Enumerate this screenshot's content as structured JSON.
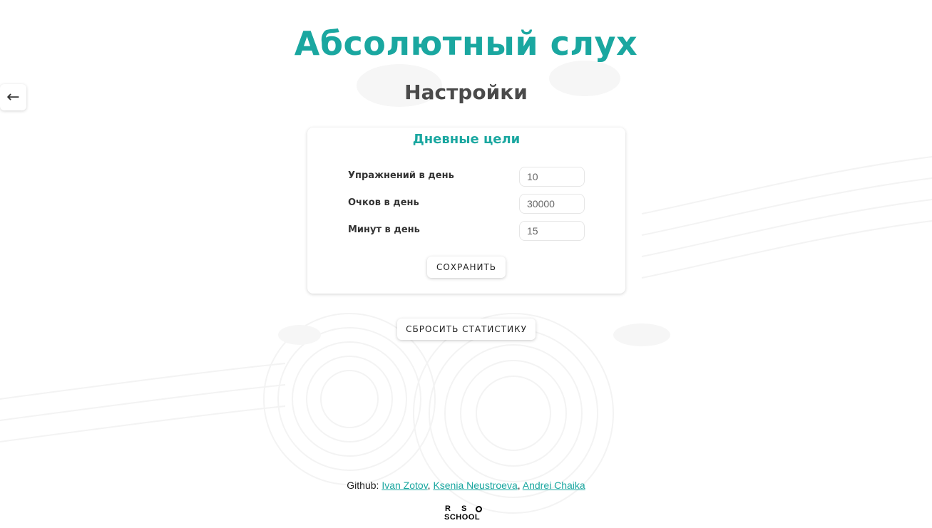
{
  "header": {
    "back_icon": "←",
    "app_title": "Абсолютный слух",
    "page_title": "Настройки"
  },
  "goals": {
    "title": "Дневные цели",
    "rows": [
      {
        "label": "Упражнений в день",
        "value": "10"
      },
      {
        "label": "Очков в день",
        "value": "30000"
      },
      {
        "label": "Минут в день",
        "value": "15"
      }
    ],
    "save_label": "СОХРАНИТЬ"
  },
  "reset_label": "СБРОСИТЬ СТАТИСТИКУ",
  "footer": {
    "prefix": "Github: ",
    "sep": ", ",
    "authors": [
      "Ivan Zotov",
      "Ksenia Neustroeva",
      "Andrei Chaika"
    ]
  },
  "logo": {
    "line1": "RS",
    "line2": "SCHOOL"
  },
  "colors": {
    "accent": "#1aa7a0",
    "heading": "#4a4a4a"
  },
  "icons": {
    "back": "arrow-left-icon",
    "logo": "rs-school-logo"
  }
}
